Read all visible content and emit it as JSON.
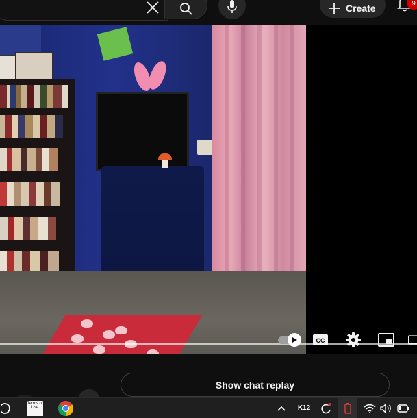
{
  "header": {
    "clear_icon": "close-icon",
    "search_icon": "search-icon",
    "mic_icon": "microphone-icon",
    "create_label": "Create",
    "create_icon": "plus-icon",
    "notifications_icon": "bell-icon",
    "notifications_badge": "9"
  },
  "player": {
    "progress_fraction": 1.0,
    "controls": [
      {
        "name": "autoplay-toggle",
        "icon": "autoplay-toggle-icon"
      },
      {
        "name": "subtitles-button",
        "icon": "cc-icon"
      },
      {
        "name": "settings-button",
        "icon": "gear-icon"
      },
      {
        "name": "miniplayer-button",
        "icon": "miniplayer-icon"
      },
      {
        "name": "theater-button",
        "icon": "theater-icon"
      }
    ]
  },
  "chat": {
    "show_chat_replay_label": "Show chat replay"
  },
  "taskbar": {
    "search_icon": "search-icon",
    "terms_label": "Terms of Use",
    "chrome_icon": "chrome-icon",
    "tray_chevron_icon": "chevron-up-icon",
    "k12_label": "K12",
    "sync_icon": "sync-icon",
    "battery_saver_icon": "battery-saver-icon",
    "wifi_icon": "wifi-icon",
    "volume_icon": "volume-icon",
    "battery_icon": "battery-icon"
  },
  "colors": {
    "background": "#0f0f0f",
    "badge": "#cc0000",
    "chrome_red": "#db4437",
    "chrome_green": "#0f9d58",
    "chrome_yellow": "#f4b400",
    "chrome_blue": "#4285f4"
  }
}
